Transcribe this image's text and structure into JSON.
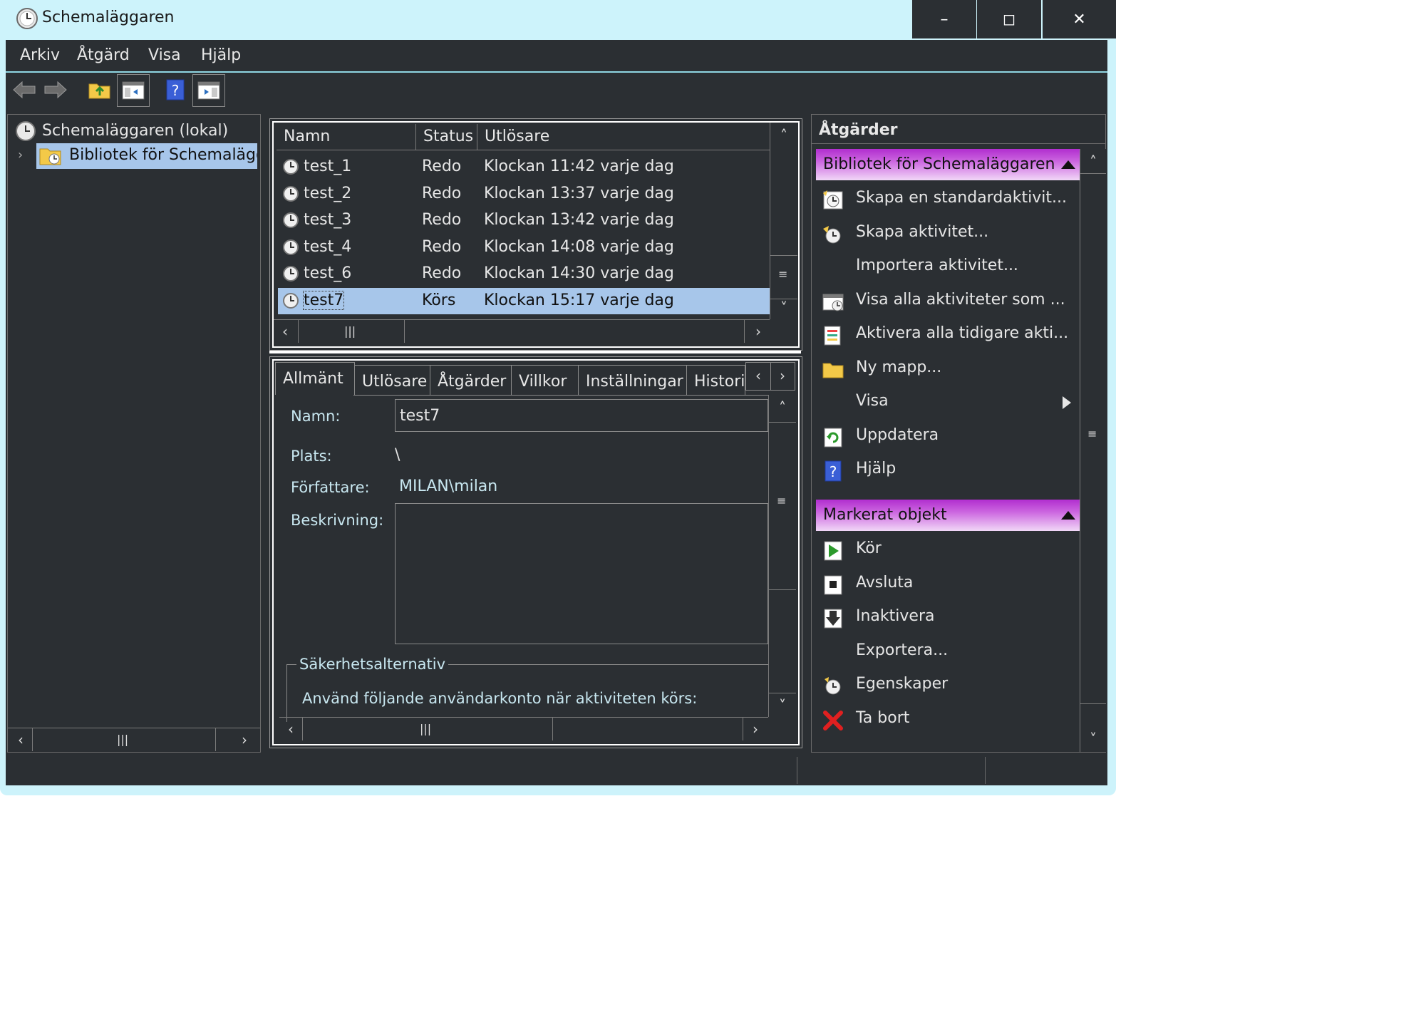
{
  "window": {
    "title": "Schemaläggaren",
    "minimize": "–",
    "maximize": "◻",
    "close": "✕"
  },
  "menu": [
    "Arkiv",
    "Åtgärd",
    "Visa",
    "Hjälp"
  ],
  "tree": {
    "root": "Schemaläggaren (lokal)",
    "child": "Bibliotek för Schemalägga"
  },
  "tasks": {
    "columns": [
      "Namn",
      "Status",
      "Utlösare"
    ],
    "rows": [
      {
        "name": "test_1",
        "status": "Redo",
        "trigger": "Klockan 11:42 varje dag"
      },
      {
        "name": "test_2",
        "status": "Redo",
        "trigger": "Klockan 13:37 varje dag"
      },
      {
        "name": "test_3",
        "status": "Redo",
        "trigger": "Klockan 13:42 varje dag"
      },
      {
        "name": "test_4",
        "status": "Redo",
        "trigger": "Klockan 14:08 varje dag"
      },
      {
        "name": "test_6",
        "status": "Redo",
        "trigger": "Klockan 14:30 varje dag"
      },
      {
        "name": "test7",
        "status": "Körs",
        "trigger": "Klockan 15:17 varje dag"
      }
    ],
    "selected_index": 5
  },
  "details": {
    "tabs": [
      "Allmänt",
      "Utlösare",
      "Åtgärder",
      "Villkor",
      "Inställningar",
      "Histori"
    ],
    "active_tab": 0,
    "name_label": "Namn:",
    "name_value": "test7",
    "location_label": "Plats:",
    "location_value": "\\",
    "author_label": "Författare:",
    "author_value": "MILAN\\milan",
    "description_label": "Beskrivning:",
    "security_group": "Säkerhetsalternativ",
    "security_text": "Använd följande användarkonto när aktiviteten körs:"
  },
  "actions": {
    "header": "Åtgärder",
    "section1": "Bibliotek för Schemaläggaren",
    "section1_items": [
      {
        "label": "Skapa en standardaktivit...",
        "icon": "create-basic-task-icon"
      },
      {
        "label": "Skapa aktivitet...",
        "icon": "create-task-icon"
      },
      {
        "label": "Importera aktivitet...",
        "icon": ""
      },
      {
        "label": "Visa alla aktiviteter som ...",
        "icon": "running-tasks-icon"
      },
      {
        "label": "Aktivera alla tidigare akti...",
        "icon": "history-icon"
      },
      {
        "label": "Ny mapp...",
        "icon": "folder-icon"
      },
      {
        "label": "Visa",
        "icon": ""
      },
      {
        "label": "Uppdatera",
        "icon": "refresh-icon"
      },
      {
        "label": "Hjälp",
        "icon": "help-icon"
      }
    ],
    "section2": "Markerat objekt",
    "section2_items": [
      {
        "label": "Kör",
        "icon": "run-icon"
      },
      {
        "label": "Avsluta",
        "icon": "stop-icon"
      },
      {
        "label": "Inaktivera",
        "icon": "disable-icon"
      },
      {
        "label": "Exportera...",
        "icon": ""
      },
      {
        "label": "Egenskaper",
        "icon": "properties-icon"
      },
      {
        "label": "Ta bort",
        "icon": "delete-icon"
      }
    ]
  },
  "colors": {
    "titlebar": "#cdf3fb",
    "panel": "#2b2f33",
    "selection": "#a7c6ea",
    "section_header": "#b12ecf"
  }
}
